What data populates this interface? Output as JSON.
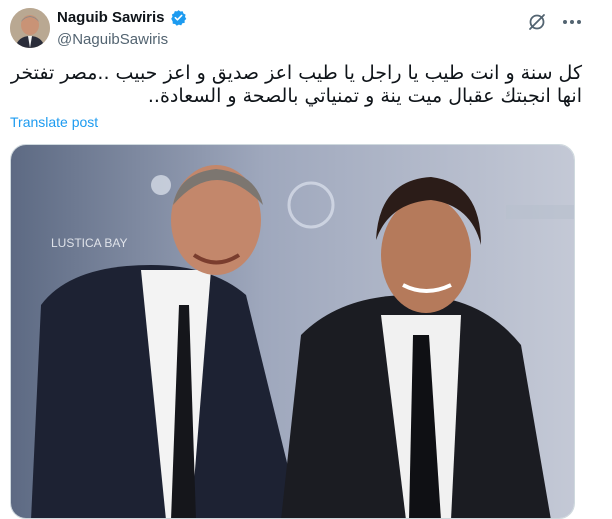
{
  "author": {
    "display_name": "Naguib Sawiris",
    "handle": "@NaguibSawiris",
    "verified": true
  },
  "post": {
    "text": "كل سنة و انت طيب يا راجل يا طيب اعز صديق و اعز حبيب ..مصر تفتخر انها انجبتك عقبال ميت ينة و تمنياتي بالصحة و السعادة..",
    "translate_label": "Translate post"
  },
  "media": {
    "backdrop_texts": [
      "LUSTICA BAY"
    ]
  },
  "icons": {
    "verified": "verified-badge-icon",
    "grok": "grok-icon",
    "more": "more-icon"
  },
  "colors": {
    "accent": "#1d9bf0",
    "text": "#0f1419",
    "secondary": "#536471"
  }
}
